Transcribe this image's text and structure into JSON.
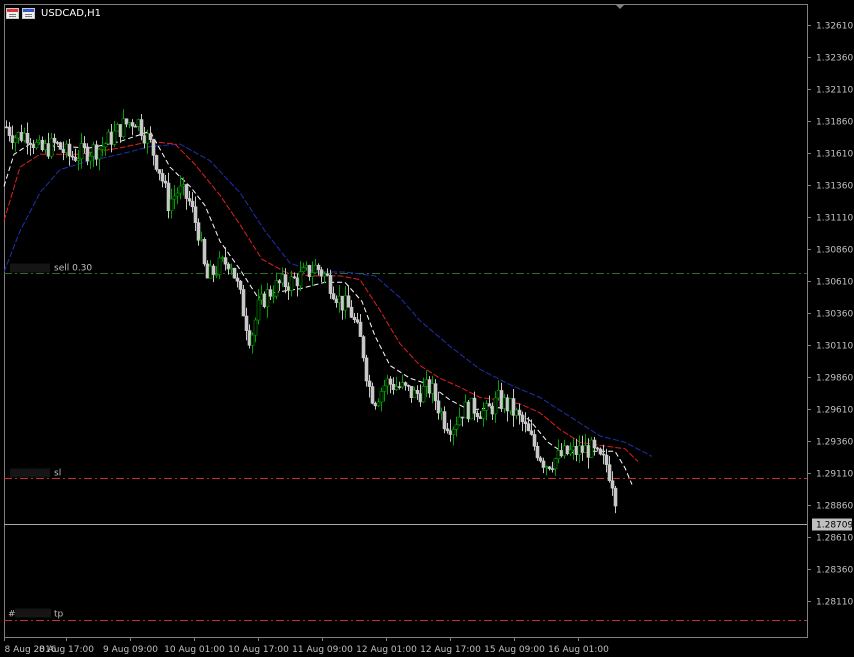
{
  "window": {
    "title": "USDCAD,H1"
  },
  "colors": {
    "background": "#000000",
    "grid": "#808080",
    "axis_text": "#c0c0c0",
    "bull_candle": "#00a000",
    "bear_candle": "#c8c8c8",
    "ma_fast": "#ffffff",
    "ma_mid": "#e02020",
    "ma_slow": "#2030b0",
    "entry_line": "#2e6f2e",
    "sl_tp_line": "#c83232",
    "current_price_line": "#a9a9a9"
  },
  "orders": {
    "sell_label": "sell 0.30",
    "sl_label": "sl",
    "tp_label": "tp",
    "tp_prefix": "#"
  },
  "chart_data": {
    "type": "candlestick",
    "symbol": "USDCAD",
    "timeframe": "H1",
    "ylim": [
      1.2792,
      1.3276
    ],
    "y_ticks": [
      "1.32610",
      "1.32360",
      "1.32110",
      "1.31860",
      "1.31610",
      "1.31360",
      "1.31110",
      "1.30860",
      "1.30610",
      "1.30360",
      "1.30110",
      "1.29860",
      "1.29610",
      "1.29360",
      "1.29110",
      "1.28860",
      "1.28610",
      "1.28360",
      "1.28110"
    ],
    "x_ticks": [
      "8 Aug 2016",
      "8 Aug 17:00",
      "9 Aug 09:00",
      "10 Aug 01:00",
      "10 Aug 17:00",
      "11 Aug 09:00",
      "12 Aug 01:00",
      "12 Aug 17:00",
      "15 Aug 09:00",
      "16 Aug 01:00"
    ],
    "current_price": "1.28709",
    "levels": {
      "entry": 1.3067,
      "sl": 1.2907,
      "tp": 1.2796
    },
    "price_path": [
      [
        0,
        1.3187
      ],
      [
        14,
        1.3174
      ],
      [
        28,
        1.3176
      ],
      [
        40,
        1.3162
      ],
      [
        55,
        1.3168
      ],
      [
        70,
        1.3158
      ],
      [
        85,
        1.3162
      ],
      [
        100,
        1.3165
      ],
      [
        112,
        1.3174
      ],
      [
        122,
        1.3182
      ],
      [
        136,
        1.3188
      ],
      [
        150,
        1.3168
      ],
      [
        160,
        1.3146
      ],
      [
        168,
        1.3122
      ],
      [
        178,
        1.3132
      ],
      [
        188,
        1.3125
      ],
      [
        198,
        1.31
      ],
      [
        206,
        1.3062
      ],
      [
        218,
        1.3072
      ],
      [
        230,
        1.3078
      ],
      [
        240,
        1.3048
      ],
      [
        250,
        1.3015
      ],
      [
        258,
        1.304
      ],
      [
        266,
        1.305
      ],
      [
        278,
        1.3058
      ],
      [
        290,
        1.306
      ],
      [
        302,
        1.3065
      ],
      [
        316,
        1.3072
      ],
      [
        328,
        1.3062
      ],
      [
        340,
        1.3045
      ],
      [
        350,
        1.3038
      ],
      [
        362,
        1.301
      ],
      [
        368,
        1.298
      ],
      [
        374,
        1.2968
      ],
      [
        386,
        1.2982
      ],
      [
        400,
        1.2978
      ],
      [
        414,
        1.2972
      ],
      [
        430,
        1.2978
      ],
      [
        444,
        1.2952
      ],
      [
        452,
        1.2948
      ],
      [
        462,
        1.296
      ],
      [
        474,
        1.2962
      ],
      [
        486,
        1.2958
      ],
      [
        498,
        1.2968
      ],
      [
        510,
        1.2962
      ],
      [
        522,
        1.295
      ],
      [
        532,
        1.2935
      ],
      [
        545,
        1.2918
      ],
      [
        555,
        1.2922
      ],
      [
        565,
        1.2926
      ],
      [
        578,
        1.2928
      ],
      [
        590,
        1.293
      ],
      [
        598,
        1.2922
      ],
      [
        606,
        1.2918
      ],
      [
        612,
        1.2905
      ],
      [
        617,
        1.2872
      ]
    ],
    "ma_fast_path": [
      [
        4,
        1.3135
      ],
      [
        14,
        1.316
      ],
      [
        30,
        1.3168
      ],
      [
        60,
        1.3166
      ],
      [
        90,
        1.3165
      ],
      [
        120,
        1.317
      ],
      [
        150,
        1.3178
      ],
      [
        170,
        1.315
      ],
      [
        190,
        1.3135
      ],
      [
        205,
        1.312
      ],
      [
        220,
        1.3092
      ],
      [
        240,
        1.307
      ],
      [
        258,
        1.3048
      ],
      [
        275,
        1.3052
      ],
      [
        300,
        1.3055
      ],
      [
        325,
        1.306
      ],
      [
        345,
        1.306
      ],
      [
        362,
        1.3045
      ],
      [
        375,
        1.3018
      ],
      [
        390,
        1.2995
      ],
      [
        410,
        1.2985
      ],
      [
        430,
        1.298
      ],
      [
        450,
        1.2968
      ],
      [
        470,
        1.296
      ],
      [
        490,
        1.2962
      ],
      [
        510,
        1.2962
      ],
      [
        530,
        1.2952
      ],
      [
        548,
        1.2935
      ],
      [
        565,
        1.2926
      ],
      [
        580,
        1.2928
      ],
      [
        600,
        1.2928
      ],
      [
        615,
        1.2928
      ],
      [
        625,
        1.2915
      ],
      [
        632,
        1.2902
      ]
    ],
    "ma_mid_path": [
      [
        4,
        1.3108
      ],
      [
        20,
        1.315
      ],
      [
        40,
        1.316
      ],
      [
        80,
        1.316
      ],
      [
        120,
        1.3165
      ],
      [
        150,
        1.317
      ],
      [
        175,
        1.3168
      ],
      [
        195,
        1.3152
      ],
      [
        220,
        1.3128
      ],
      [
        240,
        1.3105
      ],
      [
        262,
        1.3078
      ],
      [
        285,
        1.3068
      ],
      [
        310,
        1.3065
      ],
      [
        340,
        1.3065
      ],
      [
        360,
        1.3062
      ],
      [
        380,
        1.3038
      ],
      [
        400,
        1.3012
      ],
      [
        420,
        1.2995
      ],
      [
        440,
        1.2985
      ],
      [
        460,
        1.2978
      ],
      [
        480,
        1.297
      ],
      [
        500,
        1.2968
      ],
      [
        520,
        1.2965
      ],
      [
        540,
        1.2958
      ],
      [
        560,
        1.2945
      ],
      [
        580,
        1.2935
      ],
      [
        605,
        1.2932
      ],
      [
        625,
        1.293
      ],
      [
        638,
        1.292
      ]
    ],
    "ma_slow_path": [
      [
        4,
        1.3068
      ],
      [
        20,
        1.31
      ],
      [
        40,
        1.313
      ],
      [
        60,
        1.3148
      ],
      [
        90,
        1.3155
      ],
      [
        120,
        1.316
      ],
      [
        150,
        1.3166
      ],
      [
        180,
        1.3168
      ],
      [
        210,
        1.3155
      ],
      [
        240,
        1.313
      ],
      [
        265,
        1.31
      ],
      [
        290,
        1.3075
      ],
      [
        315,
        1.3068
      ],
      [
        345,
        1.3068
      ],
      [
        375,
        1.3065
      ],
      [
        400,
        1.3048
      ],
      [
        420,
        1.303
      ],
      [
        450,
        1.301
      ],
      [
        480,
        1.2992
      ],
      [
        510,
        1.298
      ],
      [
        540,
        1.297
      ],
      [
        570,
        1.2955
      ],
      [
        600,
        1.294
      ],
      [
        625,
        1.2935
      ],
      [
        652,
        1.2924
      ]
    ]
  }
}
